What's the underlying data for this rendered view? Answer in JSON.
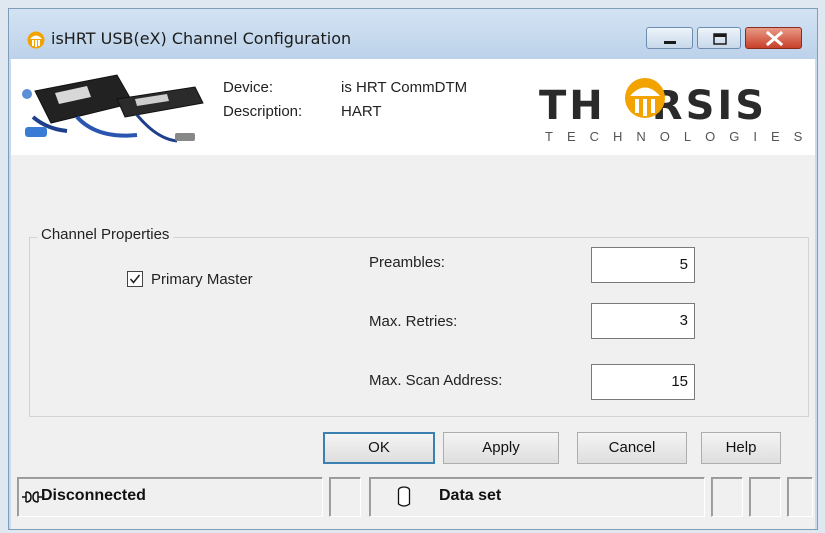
{
  "window": {
    "title": "isHRT USB(eX) Channel Configuration"
  },
  "header": {
    "device_label": "Device:",
    "device_value": "is HRT CommDTM",
    "description_label": "Description:",
    "description_value": "HART",
    "logo_text": "THORSIS",
    "logo_subtext": "TECHNOLOGIES"
  },
  "channel_properties": {
    "legend": "Channel Properties",
    "primary_master": {
      "label": "Primary Master",
      "checked": true
    },
    "fields": [
      {
        "label": "Preambles:",
        "value": "5"
      },
      {
        "label": "Max. Retries:",
        "value": "3"
      },
      {
        "label": "Max. Scan Address:",
        "value": "15"
      }
    ]
  },
  "buttons": {
    "ok": "OK",
    "apply": "Apply",
    "cancel": "Cancel",
    "help": "Help"
  },
  "statusbar": {
    "connection": "Disconnected",
    "dataset": "Data set"
  },
  "colors": {
    "close_button": "#c8402a",
    "logo_accent": "#f2a300",
    "default_button_border": "#3c7fb1"
  },
  "icons": {
    "app": "thorsis-logo-icon",
    "connection": "plug-icon",
    "dataset": "cylinder-icon",
    "check": "checkmark-icon"
  }
}
